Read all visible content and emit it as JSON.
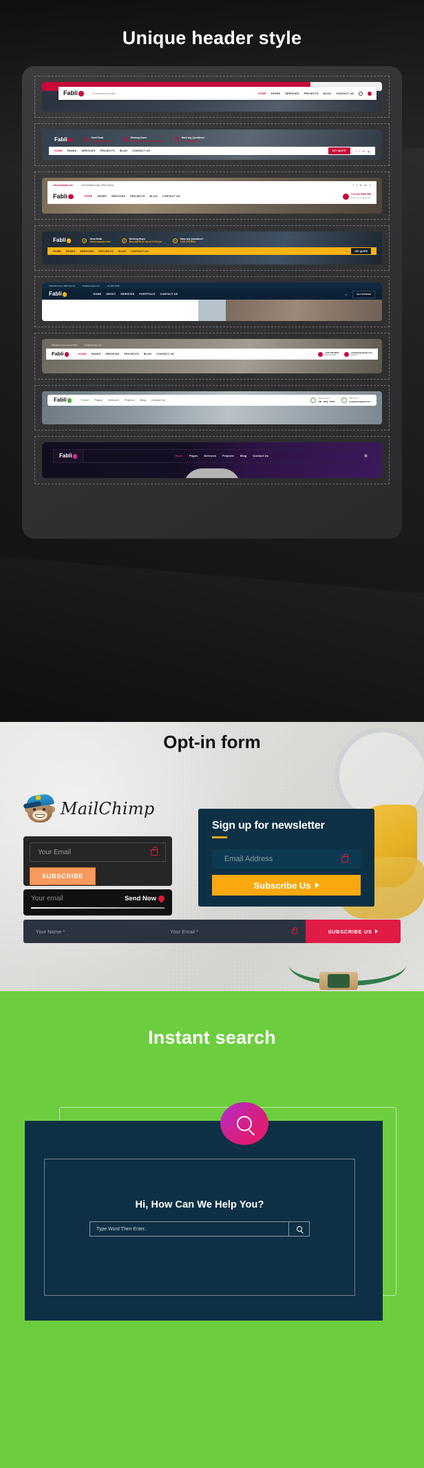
{
  "sections": {
    "headers": {
      "title": "Unique header style",
      "brand": "Fabli",
      "variants": [
        {
          "id": "header-style-1",
          "tagline": "For tomorrow's people.",
          "nav": [
            "HOME",
            "PAGES",
            "SERVICES",
            "PROJECTS",
            "BLOG",
            "CONTACT US"
          ],
          "active": "HOME",
          "icons": [
            "search-icon",
            "cart-icon"
          ]
        },
        {
          "id": "header-style-2",
          "nav": [
            "HOME",
            "PAGES",
            "SERVICES",
            "PROJECTS",
            "BLOG",
            "CONTACT US"
          ],
          "active": "HOME",
          "info": [
            {
              "label": "Send Email",
              "value": "info@example.com"
            },
            {
              "label": "Working Hours",
              "value": "Mon-Sat 09:00 am to 07:00 pm"
            },
            {
              "label": "Have any Questions?",
              "value": "+123 795 9841"
            }
          ],
          "button": "GET QUOTE",
          "social": [
            "facebook-icon",
            "twitter-icon",
            "linkedin-icon",
            "instagram-icon"
          ]
        },
        {
          "id": "header-style-3",
          "topbar": {
            "email": "info@example.com",
            "address": "Zoo Mahatas Kutiyi, 5692 Hansel"
          },
          "nav": [
            "HOME",
            "PAGES",
            "SERVICES",
            "PROJECTS",
            "BLOG",
            "CONTACT US"
          ],
          "active": "HOME",
          "phone_label": "Have any Questions?",
          "phone": "+12 523 9568 555",
          "social": [
            "facebook-icon",
            "twitter-icon",
            "behance-icon",
            "linkedin-icon",
            "search-icon"
          ]
        },
        {
          "id": "header-style-4",
          "nav": [
            "HOME",
            "PAGES",
            "SERVICES",
            "PROJECTS",
            "BLOG",
            "CONTACT US"
          ],
          "active": "HOME",
          "info": [
            {
              "label": "Send Email",
              "value": "info@example.com"
            },
            {
              "label": "Working Hours",
              "value": "Mon-Sat 09:00 am to 07:00 pm"
            },
            {
              "label": "Have any Questions?",
              "value": "+123 795 9841"
            }
          ],
          "button": "GET QUOTE"
        },
        {
          "id": "header-style-5",
          "topbar": [
            "Mahatas Kutiyi, 5692 Hansel",
            "info@example.com",
            "+12 564 0245"
          ],
          "nav": [
            "HOME",
            "ABOUT",
            "SERVICES",
            "PORTFOLIO",
            "CONTACT US"
          ],
          "active": "HOME",
          "button": "GET STARTED"
        },
        {
          "id": "header-style-6",
          "topbar": [
            "Mahatas Kutiyi Hansel 5692",
            "info@example.com"
          ],
          "nav": [
            "HOME",
            "PAGES",
            "SERVICES",
            "PROJECTS",
            "BLOG",
            "CONTACT US"
          ],
          "active": "HOME",
          "contacts": [
            {
              "label": "Call Us Now!",
              "value": "+123 795 9841"
            },
            {
              "label": "Mail Us",
              "value": "example@gmail.com"
            }
          ]
        },
        {
          "id": "header-style-7",
          "nav": [
            "Home",
            "Pages",
            "Services",
            "Projects",
            "Blog",
            "Contact Us"
          ],
          "active": "Home",
          "contacts": [
            {
              "label": "Call Us Now!",
              "value": "+38 - 2222 - 3555"
            },
            {
              "label": "Talk To Us",
              "value": "example@gmail.com"
            }
          ]
        },
        {
          "id": "header-style-8",
          "nav": [
            "Home",
            "Pages",
            "Services",
            "Projects",
            "Blog",
            "Contact Us"
          ],
          "active": "Home",
          "menu_icon": "grid-menu-icon"
        }
      ]
    },
    "optin": {
      "title": "Opt-in form",
      "mailchimp_label": "MailChimp",
      "form_a": {
        "placeholder": "Your Email",
        "button": "SUBSCRIBE",
        "lock_icon": "lock-icon"
      },
      "form_b": {
        "placeholder": "Your email",
        "button": "Send Now",
        "icon": "send-pin-icon"
      },
      "form_c": {
        "name_placeholder": "Your Name *",
        "email_placeholder": "Your Email *",
        "button": "SUBSCRIBE US",
        "lock_icon": "lock-icon"
      },
      "newsletter_card": {
        "title": "Sign up for newsletter",
        "placeholder": "Email Address",
        "button": "Subscribe Us",
        "lock_icon": "lock-icon"
      }
    },
    "search": {
      "title": "Instant search",
      "bubble_icon": "search-bubble-icon",
      "heading": "Hi, How Can We Help You?",
      "placeholder": "Type Word Then Enter..",
      "search_button_icon": "search-icon"
    }
  },
  "colors": {
    "brand_red": "#c9083a",
    "brand_yellow": "#f9b414",
    "navy": "#0e3045",
    "green": "#6cce3e",
    "orange": "#f79a5b",
    "magenta": "#e0219c"
  }
}
